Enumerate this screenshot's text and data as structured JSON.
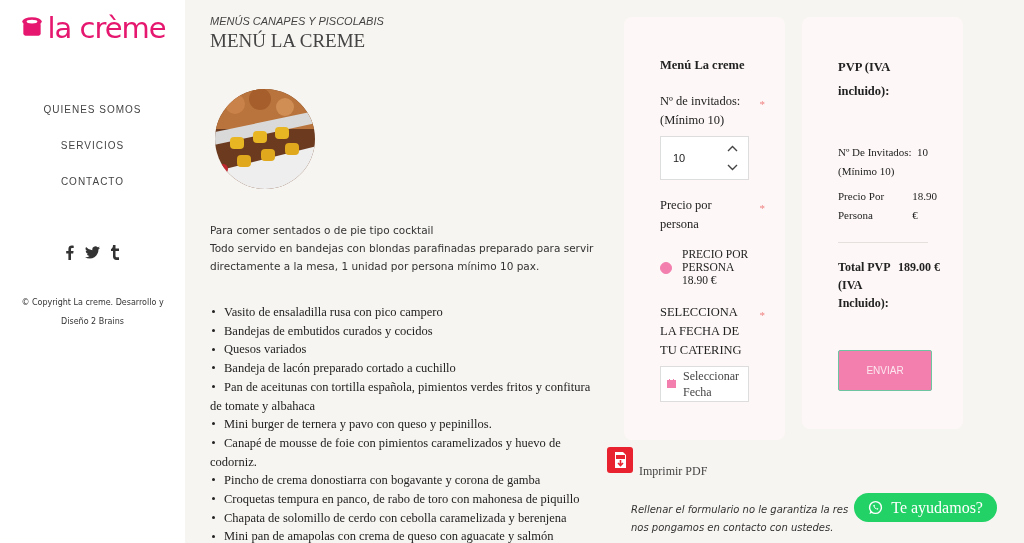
{
  "sidebar": {
    "logo": "la crème",
    "nav": [
      {
        "label": "QUIENES SOMOS"
      },
      {
        "label": "SERVICIOS"
      },
      {
        "label": "CONTACTO"
      }
    ],
    "copyright": "© Copyright La creme. Desarrollo y Diseño 2 Brains"
  },
  "content": {
    "category": "MENÚS CANAPES Y PISCOLABIS",
    "title": "MENÚ LA CREME",
    "photo": {
      "kind": "picture"
    },
    "intro": [
      "Para comer sentados o de pie tipo cocktail",
      "Todo servido en bandejas con blondas parafinadas preparado para servir directamente a la mesa, 1 unidad por persona mínimo 10 pax."
    ],
    "items": [
      "Vasito de ensaladilla rusa con pico campero",
      "Bandejas de embutidos curados y cocidos",
      "Quesos variados",
      "Bandeja de lacón preparado cortado a cuchillo",
      "Pan de aceitunas con tortilla española, pimientos verdes fritos y confitura de tomate y albahaca",
      "Mini burger de ternera y pavo con queso y pepinillos.",
      "Canapé de mousse de foie con pimientos caramelizados y huevo de codorniz.",
      "Pincho de crema donostiarra con bogavante y corona de gamba",
      "Croquetas tempura en panco, de rabo de toro con mahonesa de piquillo",
      "Chapata de solomillo de cerdo con cebolla caramelizada y berenjena",
      "Mini pan de amapolas con crema de queso con aguacate y salmón"
    ]
  },
  "form": {
    "title": "Menú La creme",
    "guests": {
      "label": "Nº de invitados: (Mínimo 10)",
      "required_mark": "*",
      "value": "10"
    },
    "price": {
      "label": "Precio por persona",
      "required_mark": "*",
      "options": [
        {
          "label": "PRECIO POR PERSONA 18.90 €",
          "selected": true
        }
      ]
    },
    "date": {
      "label": "SELECCIONA LA FECHA DE TU CATERING",
      "required_mark": "*",
      "placeholder": "Seleccionar Fecha"
    }
  },
  "summary": {
    "title": "PVP (IVA incluido):",
    "rows": [
      {
        "label": "Nº De Invitados: (Mínimo 10)",
        "value": "10"
      },
      {
        "label": "Precio Por Persona",
        "value": "18.90 €"
      }
    ],
    "total_label": "Total PVP (IVA Incluido):",
    "total_value": "189.00 €",
    "submit": "ENVIAR"
  },
  "pdf": {
    "label": "Imprimir PDF"
  },
  "note": [
    "Rellenar el formulario no le garantiza la res",
    "nos pongamos en contacto con ustedes."
  ],
  "chat_button": "Te ayudamos?"
}
